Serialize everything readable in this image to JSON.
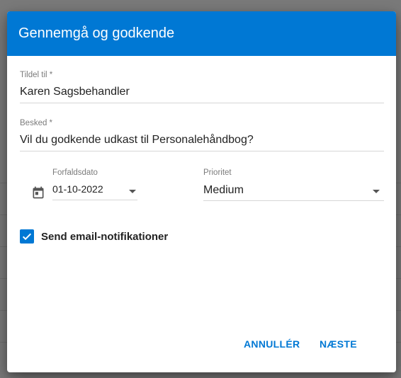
{
  "dialog": {
    "title": "Gennemgå og godkende"
  },
  "form": {
    "assign_label": "Tildel til *",
    "assign_value": "Karen Sagsbehandler",
    "message_label": "Besked *",
    "message_value": "Vil du godkende udkast til Personalehåndbog?",
    "due_label": "Forfaldsdato",
    "due_value": "01-10-2022",
    "priority_label": "Prioritet",
    "priority_value": "Medium",
    "notify_label": "Send email-notifikationer",
    "notify_checked": true
  },
  "actions": {
    "cancel_label": "ANNULLÉR",
    "next_label": "NÆSTE"
  },
  "icons": {
    "calendar": "calendar-icon",
    "dropdown": "chevron-down-icon",
    "check": "check-icon"
  },
  "colors": {
    "accent": "#0078d4",
    "text": "#222222",
    "label": "#7b7b7b",
    "backdrop": "#7a7a7a"
  }
}
